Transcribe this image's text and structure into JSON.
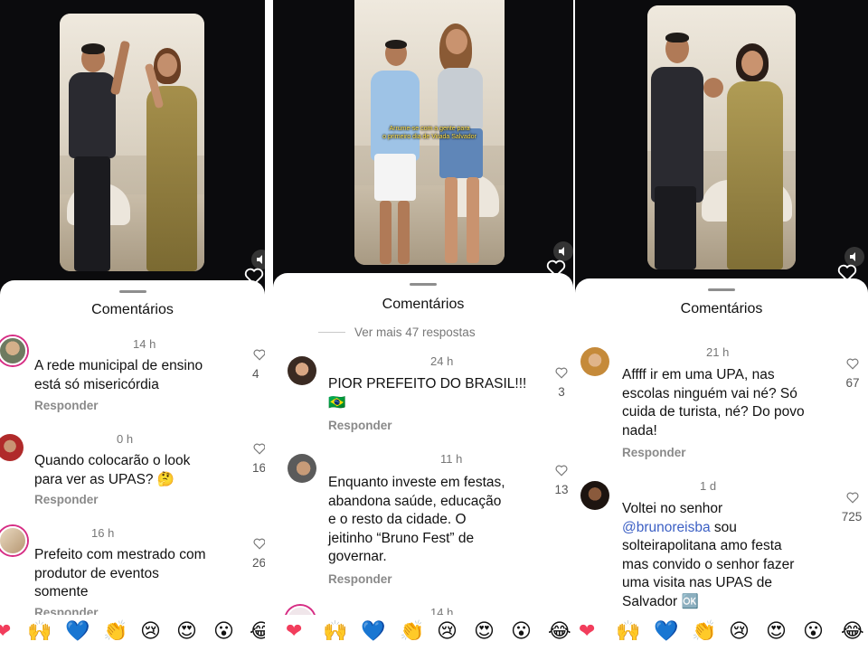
{
  "sheet_title": "Comentários",
  "reply_label": "Responder",
  "colors": {
    "mention": "#3b5fc4",
    "ring": "#d62d84",
    "subtitle": "#ffe14a"
  },
  "panel1": {
    "comments": [
      {
        "time": "14 h",
        "text_lines": [
          "A rede municipal de ensino",
          "está só  misericórdia"
        ],
        "likes": "4"
      },
      {
        "time": "0 h",
        "text_lines": [
          "Quando colocarão o look",
          "para ver as UPAS? 🤔"
        ],
        "likes": "16"
      },
      {
        "time": "16 h",
        "text_lines": [
          "Prefeito com mestrado com",
          "produtor de eventos",
          "somente"
        ],
        "likes": "26"
      }
    ],
    "partial_reply": "Responder",
    "emojis": [
      "❤",
      "🙌",
      "💙",
      "👏",
      "😢",
      "😍",
      "😮",
      "😂"
    ]
  },
  "panel2": {
    "subtitle_lines": [
      "Arrume-se com a gente para",
      "o primeiro dia de Virada Salvador"
    ],
    "more_replies": "Ver mais 47 respostas",
    "comments": [
      {
        "time": "24 h",
        "text_lines": [
          "PIOR PREFEITO DO BRASIL!!!",
          "🇧🇷"
        ],
        "likes": "3"
      },
      {
        "time": "11 h",
        "text_lines": [
          "Enquanto investe em festas,",
          "abandona saúde, educação",
          "e o resto da cidade. O",
          "jeitinho “Bruno Fest” de",
          "governar."
        ],
        "likes": "13"
      },
      {
        "time": "14 h"
      }
    ],
    "emojis": [
      "❤",
      "🙌",
      "💙",
      "👏",
      "😢",
      "😍",
      "😮",
      "😂"
    ]
  },
  "panel3": {
    "comments": [
      {
        "time": "21 h",
        "text_lines": [
          "Affff ir em uma UPA, nas",
          "escolas ninguém vai né? Só",
          "cuida de turista, né? Do povo",
          "nada!"
        ],
        "likes": "67"
      },
      {
        "time": "1 d",
        "text_line1": "Voltei no senhor",
        "mention": "@brunoreisba",
        "text_after_mention": " sou",
        "text_lines_rest": [
          "solteirapolitana amo festa",
          "mas convido o senhor fazer",
          "uma visita nas UPAS de",
          "Salvador 🆗"
        ],
        "likes": "725"
      }
    ],
    "emojis": [
      "❤",
      "🙌",
      "💙",
      "👏",
      "😢",
      "😍",
      "😮",
      "😂"
    ]
  }
}
